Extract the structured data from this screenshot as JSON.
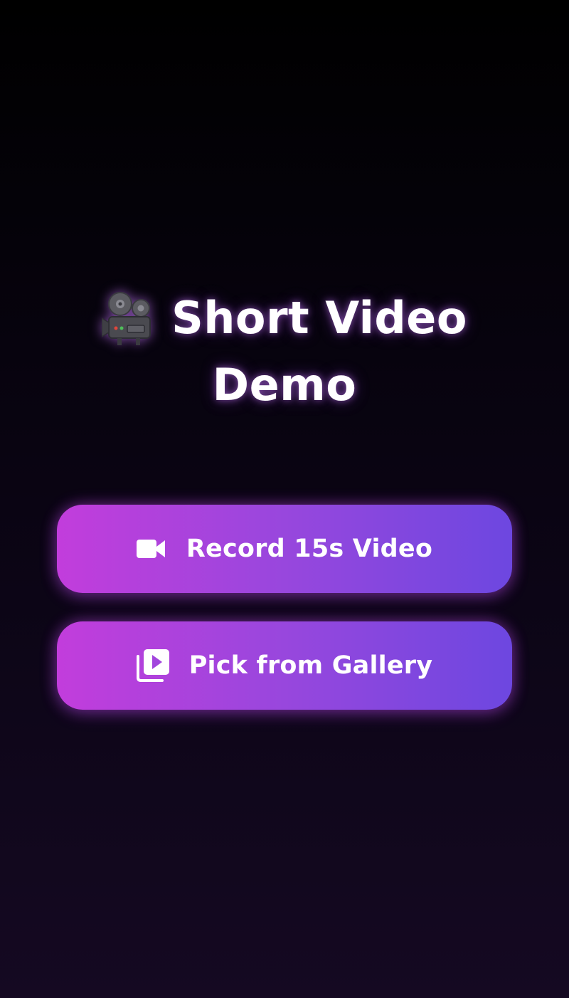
{
  "title": {
    "icon": "movie-camera-icon",
    "line1": "Short Video",
    "line2": "Demo"
  },
  "actions": {
    "record": {
      "icon": "videocam-icon",
      "label": "Record 15s Video"
    },
    "gallery": {
      "icon": "video-library-icon",
      "label": "Pick from Gallery"
    }
  },
  "colors": {
    "background_top": "#000000",
    "background_bottom": "#150922",
    "button_gradient_start": "#c23ddc",
    "button_gradient_end": "#6d47e0",
    "text": "#ffffff"
  }
}
